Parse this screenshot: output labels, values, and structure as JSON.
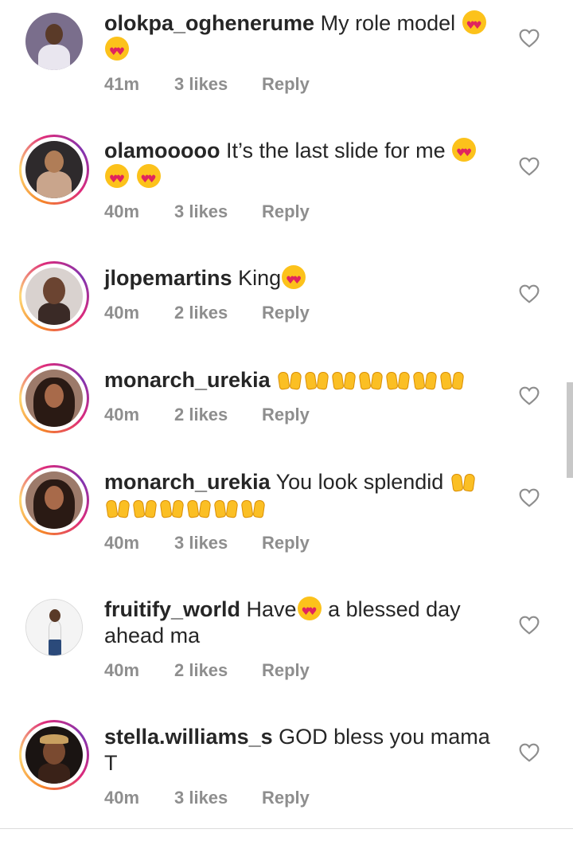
{
  "comments": [
    {
      "username": "olokpa_oghenerume",
      "text": "My role model",
      "emoji": [
        "heart-eyes",
        "heart-eyes"
      ],
      "time": "41m",
      "likes": "3 likes",
      "reply": "Reply",
      "avatar": "avatar-man-in-white"
    },
    {
      "username": "olamooooo",
      "text": "It’s the last slide for me",
      "emoji": [
        "heart-eyes",
        "heart-eyes",
        "heart-eyes"
      ],
      "time": "40m",
      "likes": "3 likes",
      "reply": "Reply",
      "avatar": "avatar-woman-sequin-dress"
    },
    {
      "username": "jlopemartins",
      "text": "King",
      "emoji": [
        "heart-eyes"
      ],
      "time": "40m",
      "likes": "2 likes",
      "reply": "Reply",
      "avatar": "avatar-woman-red-lips"
    },
    {
      "username": "monarch_urekia",
      "text": "",
      "emoji": [
        "raising-hands",
        "raising-hands",
        "raising-hands",
        "raising-hands",
        "raising-hands",
        "raising-hands",
        "raising-hands"
      ],
      "time": "40m",
      "likes": "2 likes",
      "reply": "Reply",
      "avatar": "avatar-woman-curly-hair"
    },
    {
      "username": "monarch_urekia",
      "text": "You look splendid",
      "emoji": [
        "raising-hands",
        "raising-hands",
        "raising-hands",
        "raising-hands",
        "raising-hands",
        "raising-hands",
        "raising-hands"
      ],
      "time": "40m",
      "likes": "3 likes",
      "reply": "Reply",
      "avatar": "avatar-woman-curly-hair"
    },
    {
      "username": "fruitify_world",
      "text_before": "Have",
      "text_after": " a blessed day ahead ma",
      "emoji": [
        "heart-eyes"
      ],
      "time": "40m",
      "likes": "2 likes",
      "reply": "Reply",
      "avatar": "avatar-woman-standing"
    },
    {
      "username": "stella.williams_s",
      "text": "GOD bless you mama T",
      "emoji": [],
      "time": "40m",
      "likes": "3 likes",
      "reply": "Reply",
      "avatar": "avatar-woman-leopard-headband"
    }
  ],
  "icons": {
    "like": "heart-outline-icon"
  },
  "colors": {
    "text": "#262626",
    "meta": "#8e8e8e",
    "background": "#ffffff"
  }
}
